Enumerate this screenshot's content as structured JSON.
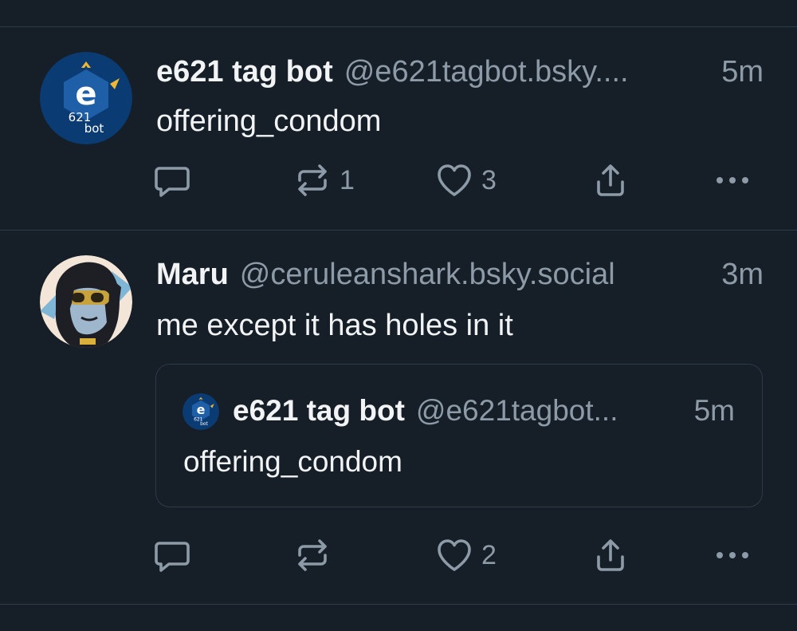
{
  "posts": [
    {
      "author_name": "e621 tag bot",
      "handle": "@e621tagbot.bsky....",
      "time": "5m",
      "text": "offering_condom",
      "avatar_icon": "e621-bot-logo",
      "replies": "",
      "reposts": "1",
      "likes": "3"
    },
    {
      "author_name": "Maru",
      "handle": "@ceruleanshark.bsky.social",
      "time": "3m",
      "text": "me except it has holes in it",
      "avatar_icon": "maru-avatar",
      "quote": {
        "author_name": "e621 tag bot",
        "handle": "@e621tagbot...",
        "time": "5m",
        "text": "offering_condom"
      },
      "replies": "",
      "reposts": "",
      "likes": "2"
    }
  ],
  "bot_avatar": {
    "letter": "e",
    "line1": "621",
    "line2": "bot"
  },
  "colors": {
    "background": "#161e27",
    "divider": "#2e3a47",
    "text_primary": "#f1f3f5",
    "text_secondary": "#8d9aa8",
    "bot_avatar_bg": "#0b3b73",
    "bot_avatar_accent": "#f0b730",
    "bot_avatar_hex": "#1e5fa8"
  },
  "icons": {
    "reply": "reply-bubble-icon",
    "repost": "repost-icon",
    "like": "heart-icon",
    "share": "share-icon",
    "more": "more-options-icon"
  }
}
